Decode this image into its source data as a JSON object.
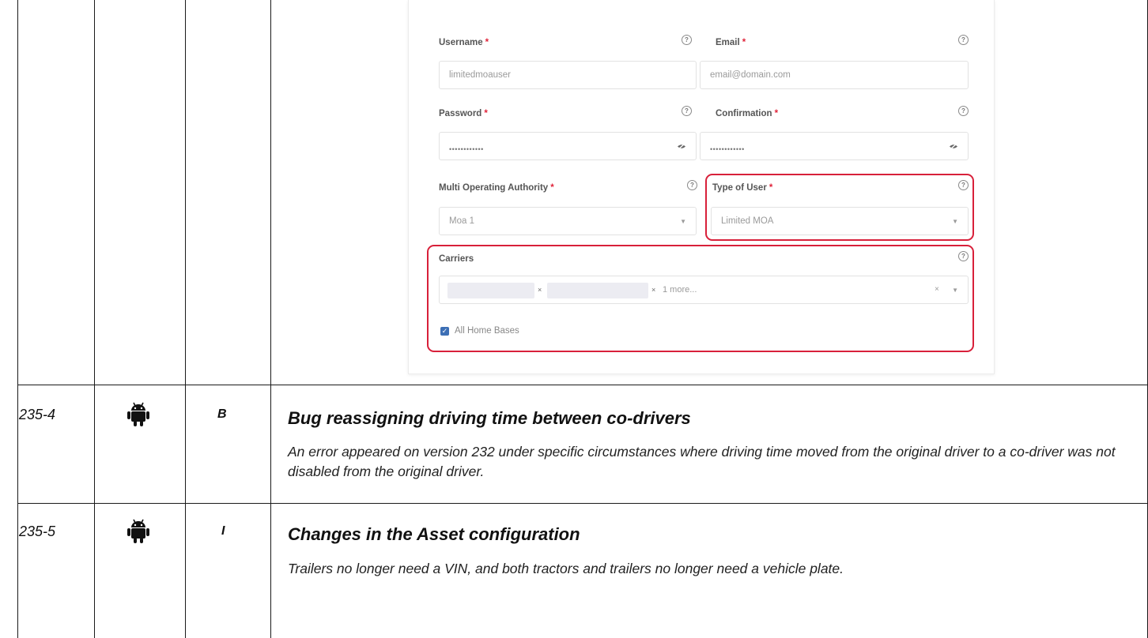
{
  "form": {
    "username": {
      "label": "Username",
      "value": "limitedmoauser"
    },
    "email": {
      "label": "Email",
      "placeholder": "email@domain.com"
    },
    "password": {
      "label": "Password",
      "mask": "••••••••••••"
    },
    "confirmation": {
      "label": "Confirmation",
      "mask": "••••••••••••"
    },
    "moa": {
      "label": "Multi Operating Authority",
      "value": "Moa 1"
    },
    "user_type": {
      "label": "Type of User",
      "value": "Limited MOA"
    },
    "carriers": {
      "label": "Carriers",
      "more": "1 more..."
    },
    "home_bases": {
      "label": "All Home Bases",
      "checked": true
    },
    "required_mark": "*",
    "help_glyph": "?",
    "highlight_color": "#d8203a"
  },
  "rows": [
    {
      "id": "235-4",
      "platform_icon": "android-icon",
      "type": "B",
      "title": "Bug reassigning driving time between co-drivers",
      "body": "An error appeared on version 232 under specific circumstances where driving time moved from the original driver to a co-driver was not disabled from the original driver."
    },
    {
      "id": "235-5",
      "platform_icon": "android-icon",
      "type": "I",
      "title": "Changes in the Asset configuration",
      "body": "Trailers no longer need a VIN, and both tractors and trailers no longer need a vehicle plate."
    }
  ]
}
